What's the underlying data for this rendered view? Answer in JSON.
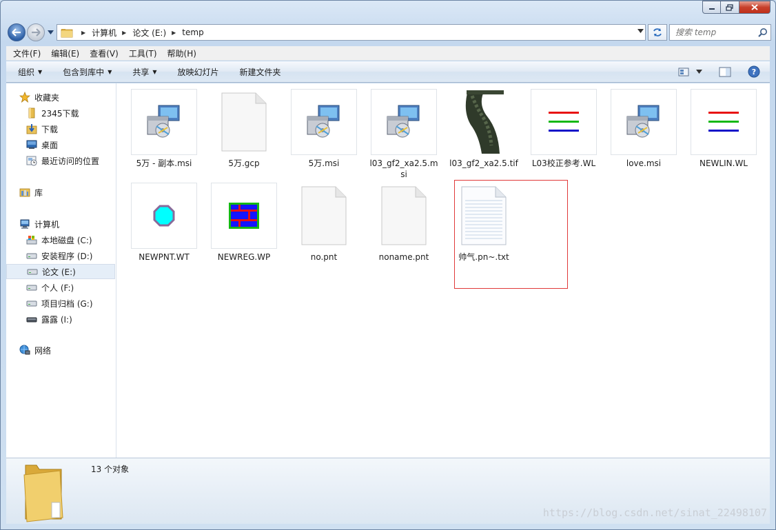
{
  "address": {
    "crumbs": [
      "计算机",
      "论文 (E:)",
      "temp"
    ]
  },
  "search": {
    "placeholder": "搜索 temp"
  },
  "menubar": [
    "文件(F)",
    "编辑(E)",
    "查看(V)",
    "工具(T)",
    "帮助(H)"
  ],
  "commands": {
    "organize": "组织",
    "include": "包含到库中",
    "share": "共享",
    "slideshow": "放映幻灯片",
    "new_folder": "新建文件夹"
  },
  "nav": {
    "favorites": "收藏夹",
    "fav_2345": "2345下载",
    "fav_downloads": "下载",
    "fav_desktop": "桌面",
    "fav_recent": "最近访问的位置",
    "libraries": "库",
    "computer": "计算机",
    "drive_c": "本地磁盘 (C:)",
    "drive_d": "安装程序 (D:)",
    "drive_e": "论文 (E:)",
    "drive_f": "个人 (F:)",
    "drive_g": "项目归档 (G:)",
    "drive_i": "露露 (I:)",
    "network": "网络"
  },
  "files": [
    {
      "name": "5万 - 副本.msi",
      "icon": "msi-installer-icon"
    },
    {
      "name": "5万.gcp",
      "icon": "blank-file-icon"
    },
    {
      "name": "5万.msi",
      "icon": "msi-installer-icon"
    },
    {
      "name": "l03_gf2_xa2.5.msi",
      "icon": "msi-installer-icon"
    },
    {
      "name": "l03_gf2_xa2.5.tif",
      "icon": "tif-image-thumbnail"
    },
    {
      "name": "L03校正参考.WL",
      "icon": "wl-lines-thumbnail"
    },
    {
      "name": "love.msi",
      "icon": "msi-installer-icon"
    },
    {
      "name": "NEWLIN.WL",
      "icon": "wl-lines-thumbnail"
    },
    {
      "name": "NEWPNT.WT",
      "icon": "wt-point-thumbnail"
    },
    {
      "name": "NEWREG.WP",
      "icon": "wp-region-thumbnail"
    },
    {
      "name": "no.pnt",
      "icon": "blank-file-icon"
    },
    {
      "name": "noname.pnt",
      "icon": "blank-file-icon"
    },
    {
      "name": "帅气.pn~.txt",
      "icon": "text-file-icon"
    }
  ],
  "details": {
    "count": "13 个对象"
  },
  "watermark": "https://blog.csdn.net/sinat_22498107",
  "colors": {
    "selection_border": "#e03838",
    "line_red": "#e81010",
    "line_green": "#14b814",
    "line_blue": "#1010c8",
    "point_cyan": "#00ffff",
    "region_blue": "#1414ff",
    "region_red": "#e81010",
    "region_green": "#14b814"
  }
}
